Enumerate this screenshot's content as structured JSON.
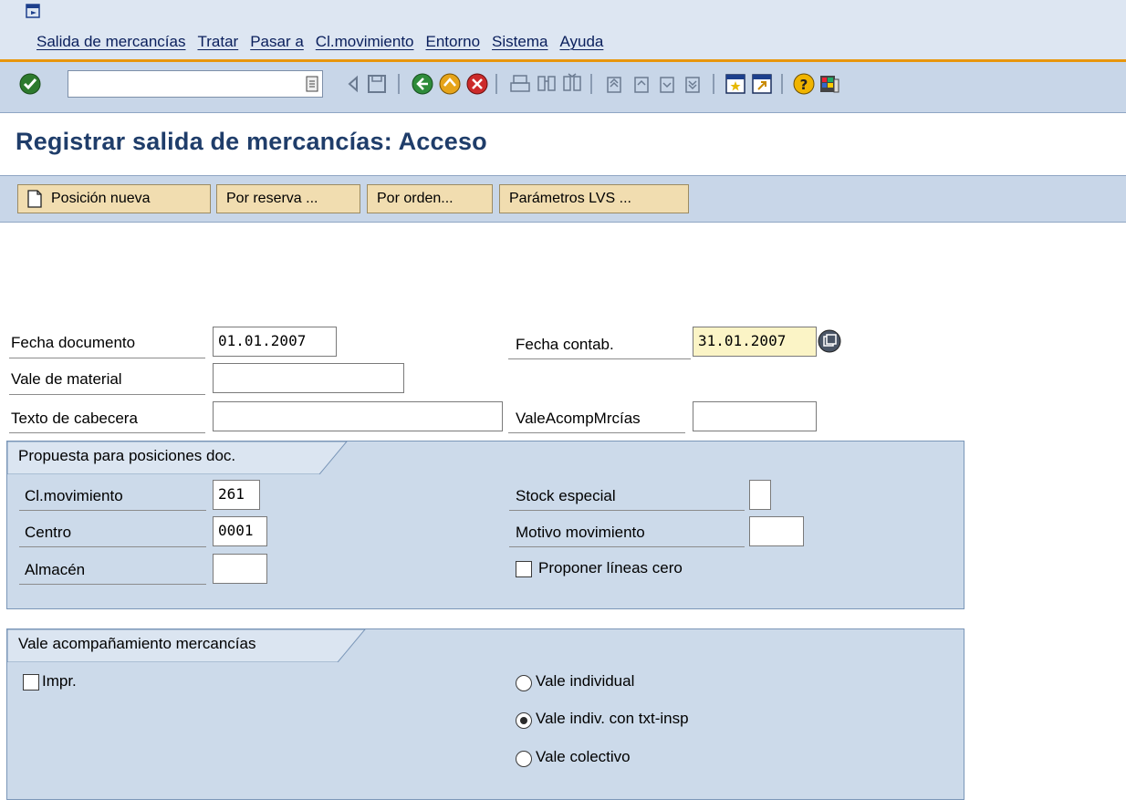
{
  "menu": {
    "items": [
      "Salida de mercancías",
      "Tratar",
      "Pasar a",
      "Cl.movimiento",
      "Entorno",
      "Sistema",
      "Ayuda"
    ]
  },
  "toolbar": {
    "command_field_value": "",
    "icons": [
      "enter-icon",
      "back-icon",
      "save-icon",
      "back-green-icon",
      "exit-icon",
      "cancel-icon",
      "print-icon",
      "find-icon",
      "find-next-icon",
      "first-page-icon",
      "previous-page-icon",
      "next-page-icon",
      "last-page-icon",
      "create-session-icon",
      "shortcut-icon",
      "help-icon",
      "layout-icon"
    ]
  },
  "page": {
    "title": "Registrar salida de mercancías: Acceso"
  },
  "app_toolbar": {
    "new_item": "Posición nueva",
    "by_reservation": "Por reserva ...",
    "by_order": "Por orden...",
    "lvs_params": "Parámetros LVS ..."
  },
  "header": {
    "doc_date_label": "Fecha documento",
    "doc_date_value": "01.01.2007",
    "posting_date_label": "Fecha contab.",
    "posting_date_value": "31.01.2007",
    "material_slip_label": "Vale de material",
    "material_slip_value": "",
    "header_text_label": "Texto de cabecera",
    "header_text_value": "",
    "goods_receipt_slip_label": "ValeAcompMrcías",
    "goods_receipt_slip_value": ""
  },
  "defaults_group": {
    "title": "Propuesta para posiciones doc.",
    "movement_type_label": "Cl.movimiento",
    "movement_type_value": "261",
    "plant_label": "Centro",
    "plant_value": "0001",
    "storage_location_label": "Almacén",
    "storage_location_value": "",
    "special_stock_label": "Stock especial",
    "special_stock_value": "",
    "reason_label": "Motivo movimiento",
    "reason_value": "",
    "suggest_zero_label": "Proponer líneas cero",
    "suggest_zero_checked": false
  },
  "slip_group": {
    "title": "Vale acompañamiento mercancías",
    "print_label": "Impr.",
    "print_checked": false,
    "options": [
      "Vale individual",
      "Vale indiv. con txt-insp",
      "Vale colectivo"
    ],
    "selected_option": "Vale indiv. con txt-insp"
  }
}
